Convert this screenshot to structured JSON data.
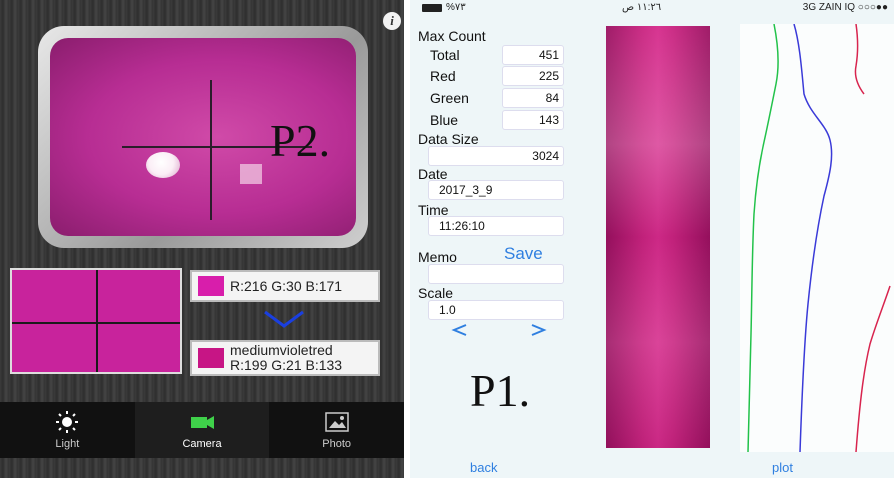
{
  "left": {
    "info_glyph": "i",
    "viewer_label": "P2.",
    "rgb_readout": "R:216 G:30 B:171",
    "color_name": "mediumvioletred",
    "color_name_rgb": "R:199 G:21 B:133",
    "tabs": [
      {
        "label": "Light",
        "icon": "sun-icon"
      },
      {
        "label": "Camera",
        "icon": "camera-icon"
      },
      {
        "label": "Photo",
        "icon": "photo-icon"
      }
    ],
    "colors": {
      "sampled": "#d81eab",
      "named": "#c71585",
      "preview": "#c8239c"
    }
  },
  "right": {
    "status": {
      "battery": "%٧٣",
      "time": "١١:٢٦ ص",
      "carrier": "3G  ZAIN IQ ○○○●●"
    },
    "max_count_label": "Max Count",
    "total_label": "Total",
    "total_value": "451",
    "red_label": "Red",
    "red_value": "225",
    "green_label": "Green",
    "green_value": "84",
    "blue_label": "Blue",
    "blue_value": "143",
    "data_size_label": "Data Size",
    "data_size_value": "3024",
    "date_label": "Date",
    "date_value": "2017_3_9",
    "time_label": "Time",
    "time_value": "11:26:10",
    "memo_label": "Memo",
    "save_label": "Save",
    "memo_value": "",
    "scale_label": "Scale",
    "scale_value": "1.0",
    "prev_glyph": "<",
    "next_glyph": ">",
    "strip_label": "P1.",
    "back_label": "back",
    "plot_label": "plot",
    "plot_colors": {
      "green": "#22c24a",
      "blue": "#3a3ad8",
      "red": "#d8244e"
    }
  }
}
